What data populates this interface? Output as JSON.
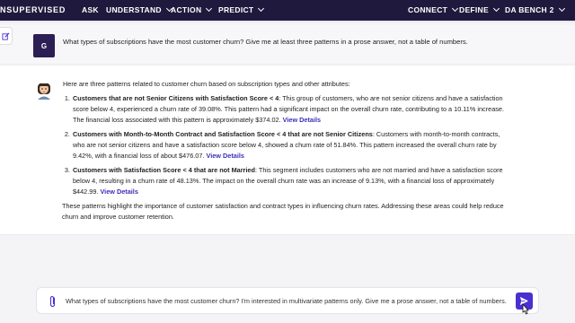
{
  "nav": {
    "brand": "NSUPERVISED",
    "items": [
      {
        "label": "ASK",
        "has_menu": false
      },
      {
        "label": "UNDERSTAND",
        "has_menu": true
      },
      {
        "label": "ACTION",
        "has_menu": true
      },
      {
        "label": "PREDICT",
        "has_menu": true
      }
    ],
    "right_items": [
      {
        "label": "CONNECT",
        "has_menu": true
      },
      {
        "label": "DEFINE",
        "has_menu": true
      },
      {
        "label": "DA BENCH 2",
        "has_menu": true
      }
    ]
  },
  "question": {
    "avatar_initial": "G",
    "text": "What types of subscriptions have the most customer churn? Give me at least three patterns in a prose answer, not a table of numbers."
  },
  "answer": {
    "intro": "Here are three patterns related to customer churn based on subscription types and other attributes:",
    "patterns": [
      {
        "title": "Customers that are not Senior Citizens with Satisfaction Score < 4",
        "text": ": This group of customers, who are not senior citizens and have a satisfaction score below 4, experienced a churn rate of 39.08%. This pattern had a significant impact on the overall churn rate, contributing to a 10.11% increase. The financial loss associated with this pattern is approximately $374.02.",
        "link": "View Details"
      },
      {
        "title": "Customers with Month-to-Month Contract and Satisfaction Score < 4 that are not Senior Citizens",
        "text": ": Customers with month-to-month contracts, who are not senior citizens and have a satisfaction score below 4, showed a churn rate of 51.84%. This pattern increased the overall churn rate by 9.42%, with a financial loss of about $476.07.",
        "link": "View Details"
      },
      {
        "title": "Customers with Satisfaction Score < 4 that are not Married",
        "text": ": This segment includes customers who are not married and have a satisfaction score below 4, resulting in a churn rate of 48.13%. The impact on the overall churn rate was an increase of 9.13%, with a financial loss of approximately $442.99.",
        "link": "View Details"
      }
    ],
    "conclusion": "These patterns highlight the importance of customer satisfaction and contract types in influencing churn rates. Addressing these areas could help reduce churn and improve customer retention."
  },
  "input": {
    "value": "What types of subscriptions have the most customer churn? I'm interested in multivariate patterns only. Give me a prose answer, not a table of numbers."
  },
  "colors": {
    "nav_bg": "#1f1a3d",
    "accent": "#4a2fd1",
    "link": "#3d2fb8"
  },
  "icons": {
    "edit": "edit-icon",
    "attach": "paperclip-icon",
    "send": "send-icon",
    "bot": "bot-avatar-icon"
  }
}
